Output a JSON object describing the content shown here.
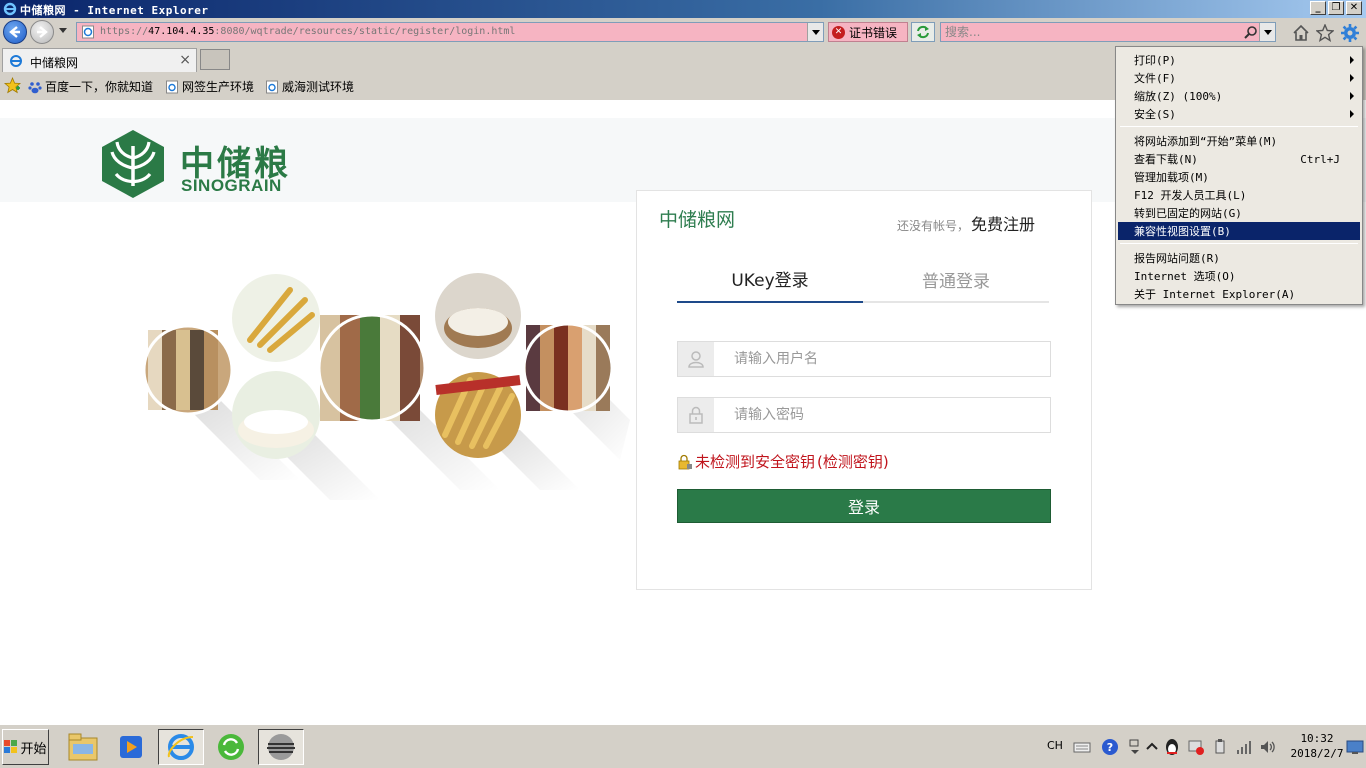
{
  "window": {
    "title": "中储粮网 - Internet Explorer",
    "buttons": {
      "minimize": "_",
      "restore": "❐",
      "close": "✕"
    }
  },
  "address_bar": {
    "url_prefix": "https://",
    "url_host": "47.104.4.35",
    "url_rest": ":8080/wqtrade/resources/static/register/login.html",
    "cert_error_label": "证书错误",
    "search_placeholder": "搜索..."
  },
  "tabs": [
    {
      "label": "中储粮网",
      "close": "×"
    }
  ],
  "favorites": [
    {
      "label": "百度一下，你就知道",
      "icon": "baidu-icon"
    },
    {
      "label": "网签生产环境",
      "icon": "ie-page-icon"
    },
    {
      "label": "威海测试环境",
      "icon": "ie-page-icon"
    }
  ],
  "page": {
    "logo": {
      "cn": "中储粮",
      "en": "SINOGRAIN"
    },
    "login": {
      "title": "中储粮网",
      "no_account": "还没有帐号，",
      "register_link": "免费注册",
      "tab_ukey": "UKey登录",
      "tab_normal": "普通登录",
      "username_placeholder": "请输入用户名",
      "password_placeholder": "请输入密码",
      "key_warning": "未检测到安全密钥",
      "detect_link": "(检测密钥)",
      "login_button": "登录"
    },
    "colors": {
      "brand_green": "#2a7a48",
      "warning_red": "#c0141c",
      "active_tab_underline": "#1e4a8a"
    }
  },
  "menu": {
    "items": [
      {
        "label": "打印(P)",
        "submenu": true
      },
      {
        "label": "文件(F)",
        "submenu": true
      },
      {
        "label": "缩放(Z) (100%)",
        "submenu": true
      },
      {
        "label": "安全(S)",
        "submenu": true
      },
      {
        "label": "将网站添加到“开始”菜单(M)"
      },
      {
        "label": "查看下载(N)",
        "shortcut": "Ctrl+J"
      },
      {
        "label": "管理加载项(M)"
      },
      {
        "label": "F12 开发人员工具(L)"
      },
      {
        "label": "转到已固定的网站(G)"
      },
      {
        "label": "兼容性视图设置(B)",
        "highlighted": true
      },
      {
        "label": "报告网站问题(R)"
      },
      {
        "label": "Internet 选项(O)"
      },
      {
        "label": "关于 Internet Explorer(A)"
      }
    ]
  },
  "taskbar": {
    "start_label": "开始",
    "apps": [
      "file-explorer-icon",
      "media-player-icon",
      "internet-explorer-icon",
      "green-refresh-app-icon",
      "striped-app-icon"
    ],
    "language": "CH",
    "clock_time": "10:32",
    "clock_date": "2018/2/7"
  }
}
